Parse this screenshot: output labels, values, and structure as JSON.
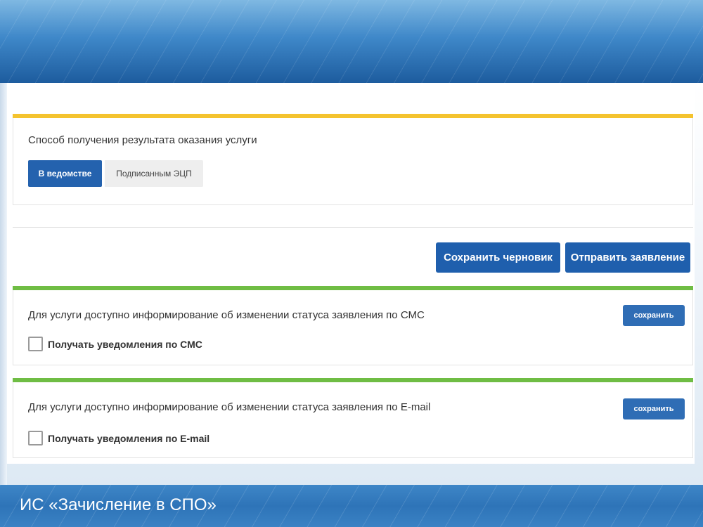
{
  "result_section": {
    "title": "Способ получения результата оказания услуги",
    "options": [
      "В ведомстве",
      "Подписанным ЭЦП"
    ],
    "selected": "В ведомстве"
  },
  "actions": {
    "save_draft": "Сохранить черновик",
    "submit": "Отправить заявление"
  },
  "sms_section": {
    "title": "Для услуги доступно информирование об изменении статуса заявления по СМС",
    "checkbox_label": "Получать уведомления по СМС",
    "checked": false,
    "save_label": "сохранить"
  },
  "email_section": {
    "title": "Для услуги доступно информирование об изменении статуса заявления по E-mail",
    "checkbox_label": "Получать уведомления по E-mail",
    "checked": false,
    "save_label": "сохранить"
  },
  "footer": {
    "title": "ИС «Зачисление в СПО»"
  },
  "colors": {
    "primary": "#1f5fad",
    "yellow_accent": "#f4c32e",
    "green_accent": "#6fbd44",
    "banner": "#2f72b5"
  }
}
